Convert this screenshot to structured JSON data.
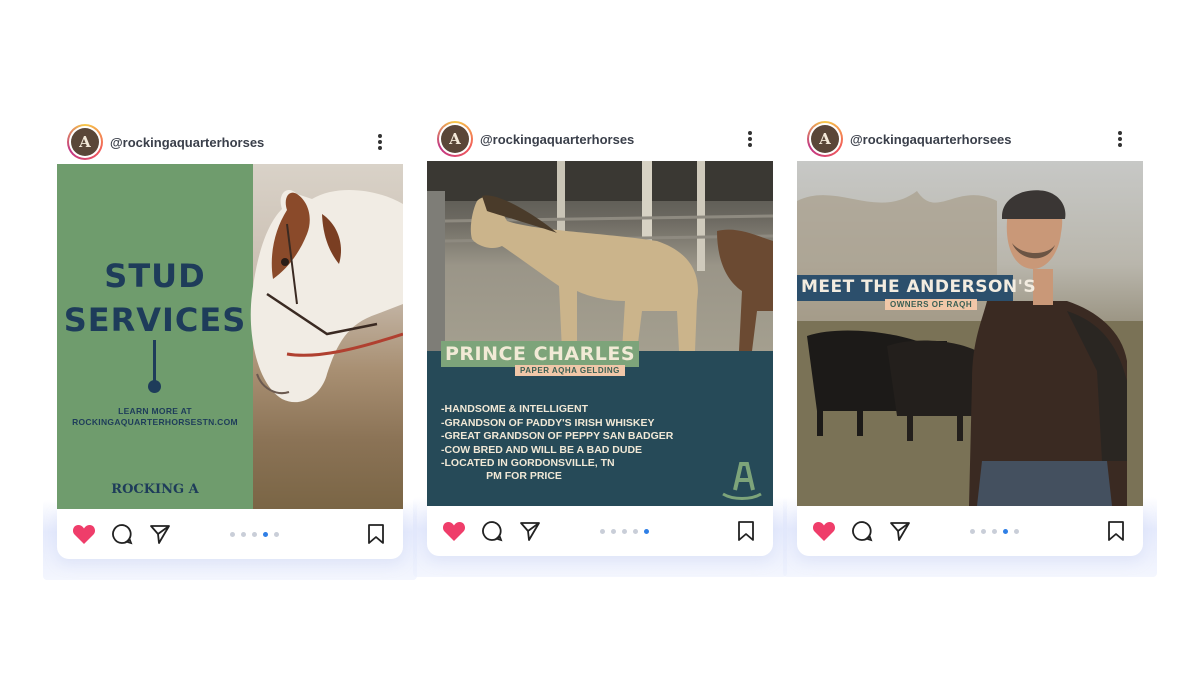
{
  "posts": [
    {
      "handle": "@rockingaquarterhorses",
      "title_line1": "STUD",
      "title_line2": "SERVICES",
      "learn_line1": "LEARN MORE AT",
      "learn_line2": "ROCKINGAQUARTERHORSESTN.COM",
      "brand": "ROCKING A",
      "active_dot": 4
    },
    {
      "handle": "@rockingaquarterhorses",
      "name": "PRINCE CHARLES",
      "subtitle": "PAPER AQHA GELDING",
      "bullets": [
        "-HANDSOME & INTELLIGENT",
        "-GRANDSON OF PADDY'S IRISH WHISKEY",
        "-GREAT GRANDSON OF PEPPY SAN BADGER",
        "-COW BRED AND WILL BE A BAD DUDE",
        "-LOCATED IN GORDONSVILLE, TN"
      ],
      "cta": "PM FOR PRICE",
      "active_dot": 5
    },
    {
      "handle": "@rockingaquarterhorsees",
      "title": "MEET THE ANDERSON'S",
      "subtitle": "OWNERS OF RAQH",
      "active_dot": 4
    }
  ],
  "colors": {
    "heart": "#ef3d6a",
    "active_dot": "#2f7fe6",
    "stud_green": "#6f9c6d",
    "teal_panel": "#264a58",
    "title_blue": "#1e3c5a"
  },
  "icons": [
    "heart-icon",
    "comment-icon",
    "share-icon",
    "bookmark-icon",
    "more-icon"
  ]
}
